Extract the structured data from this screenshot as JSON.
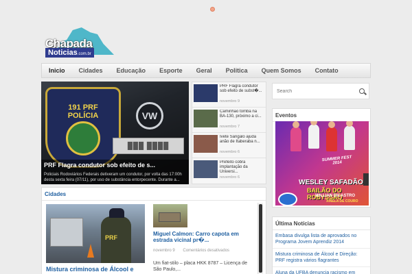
{
  "logo": {
    "line1": "Chapada",
    "line2": "Noticias",
    "suffix": ".com.br"
  },
  "nav": {
    "items": [
      {
        "label": "Inicio",
        "active": true
      },
      {
        "label": "Cidades"
      },
      {
        "label": "Educação"
      },
      {
        "label": "Esporte"
      },
      {
        "label": "Geral"
      },
      {
        "label": "Politica"
      },
      {
        "label": "Quem Somos"
      },
      {
        "label": "Contato"
      }
    ]
  },
  "slider": {
    "badge": "191 PRF POLÍCIA",
    "plate": "███ ████",
    "title": "PRF Flagra condutor sob efeito de s...",
    "excerpt": "Policiais Rodoviários Federais detiveram um condutor, por volta das 17:00h desta sexta feira (07/11), por uso de substância entorpecente. Durante a..."
  },
  "news_list": [
    {
      "title": "PRF Flagra condutor sob efeito de subst�...",
      "date": "novembro 9",
      "color": "#2b3a6a"
    },
    {
      "title": "Caminhão tomba na BA-130, próximo a ci...",
      "date": "novembro 7",
      "color": "#5a6b4a"
    },
    {
      "title": "Ivete Sangalo ajuda anão de Itaberaba n...",
      "date": "novembro 6",
      "color": "#8a5a4a"
    },
    {
      "title": "Prefeito cobra implantação da Universi...",
      "date": "novembro 6",
      "color": "#4a5a7a"
    }
  ],
  "search": {
    "placeholder": "Search"
  },
  "eventos": {
    "title": "Eventos",
    "poster": {
      "fest": "SUMMER FEST",
      "year": "2014",
      "line1": "WESLEY SAFADÃO",
      "line2": "BAILÃO DO ROBYSSÃO",
      "line3": "WILLIAN DICASTRO",
      "line4": "XINELA DE COURO"
    }
  },
  "cidades": {
    "title": "Cidades",
    "main_title": "Mistura criminosa de Álcool e",
    "side_title": "Miguel Calmon: Carro capota em estrada vicinal pr�...",
    "side_date": "novembro 9",
    "side_comments": "Comentários desativados",
    "side_excerpt": "Um fiat-stilo – placa HKK 8787 – Licença de São Paulo,..."
  },
  "ultimas": {
    "title": "Última Notícias",
    "items": [
      "Embasa divulga lista de aprovados no Programa Jovem Aprendiz 2014",
      "Mistura criminosa de Álcool e Direção: PRF registra vários flagrantes",
      "Aluna da UFBA denuncia racismo em"
    ]
  }
}
